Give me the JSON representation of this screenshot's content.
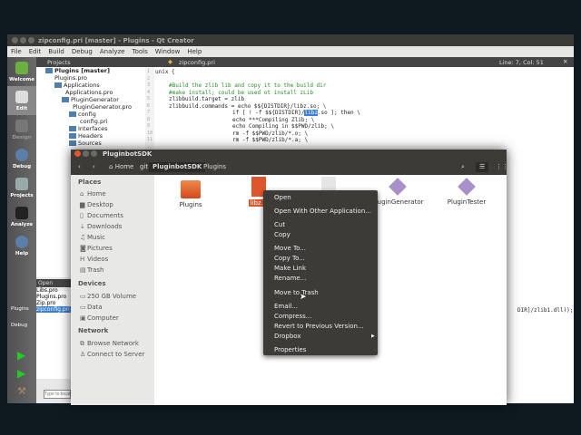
{
  "qt": {
    "title": "zipconfig.pri [master] - Plugins - Qt Creator",
    "menu": [
      "File",
      "Edit",
      "Build",
      "Debug",
      "Analyze",
      "Tools",
      "Window",
      "Help"
    ],
    "projects_label": "Projects",
    "editor_tab": "zipconfig.pri",
    "cursor_pos": "Line: 7, Col: 51",
    "modes": [
      "Welcome",
      "Edit",
      "Design",
      "Debug",
      "Projects",
      "Analyze",
      "Help"
    ],
    "tree": [
      "Plugins [master]",
      "Plugins.pro",
      "Applications",
      "Applications.pro",
      "PluginGenerator",
      "PluginGenerator.pro",
      "config",
      "config.pri",
      "Interfaces",
      "Headers",
      "Sources"
    ],
    "code": {
      "l1": "unix {",
      "l3": "#Build the zlib lib and copy it to the build dir",
      "l4": "#make install; could be used ot install zLib",
      "l5": "zlibbuild.target = zlib",
      "l6": "zlibbuild.commands = echo $${DISTDIR}/libz.so; \\",
      "l7a": "if [ ! -f $${DISTDIR}/",
      "l7b": "libz",
      "l7c": ".so ]; then \\",
      "l8": "echo ***Compiling Zlib; \\",
      "l9": "echo Compiling in $$PWD/zlib; \\",
      "l10": "rm -f $$PWD/zlib/*.o; \\",
      "l11": "rm -f $$PWD/zlib/*.a; \\",
      "tail": "DIR]/zlib1.dll));"
    },
    "open_docs_label": "Open Documents",
    "open_docs": [
      "Libs.pro",
      "Plugins.pro",
      "Zip.pro",
      "zipconfig.pri"
    ],
    "kit_label": "Plugins",
    "kit_mode": "Debug",
    "locator_placeholder": "Type to locate"
  },
  "fm": {
    "title": "PluginbotSDK",
    "crumbs": [
      "Home",
      "git",
      "PluginbotSDK",
      "Plugins"
    ],
    "places_label": "Places",
    "places": [
      "Home",
      "Desktop",
      "Documents",
      "Downloads",
      "Music",
      "Pictures",
      "Videos",
      "Trash"
    ],
    "devices_label": "Devices",
    "devices": [
      "250 GB Volume",
      "Data",
      "Computer"
    ],
    "network_label": "Network",
    "network": [
      "Browse Network",
      "Connect to Server"
    ],
    "files": [
      "Plugins",
      "libz...",
      "",
      "PluginGenerator",
      "PluginTester"
    ]
  },
  "ctx": [
    "Open",
    "Open With Other Application...",
    "Cut",
    "Copy",
    "Move To...",
    "Copy To...",
    "Make Link",
    "Rename...",
    "Move to Trash",
    "Email...",
    "Compress...",
    "Revert to Previous Version...",
    "Dropbox",
    "Properties"
  ]
}
